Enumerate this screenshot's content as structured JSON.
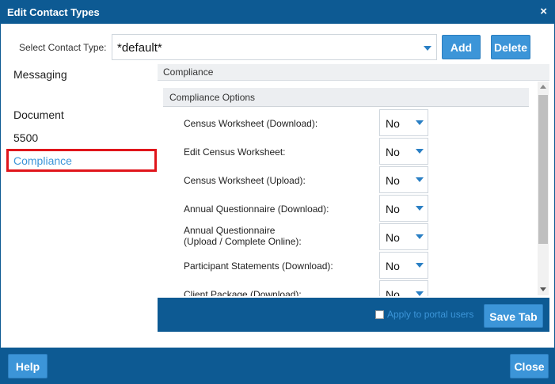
{
  "dialog": {
    "title": "Edit Contact Types",
    "close_glyph": "×"
  },
  "contact_type": {
    "label": "Select Contact Type:",
    "value": "*default*",
    "add_label": "Add",
    "delete_label": "Delete"
  },
  "nav": {
    "items": [
      {
        "label": "Messaging",
        "selected": false
      },
      {
        "label": "Document",
        "selected": false
      },
      {
        "label": "5500",
        "selected": false
      },
      {
        "label": "Compliance",
        "selected": true
      }
    ]
  },
  "panel": {
    "header": "Compliance",
    "section_title": "Compliance Options",
    "rows": [
      {
        "label": "Census Worksheet (Download):",
        "value": "No"
      },
      {
        "label": "Edit Census Worksheet:",
        "value": "No"
      },
      {
        "label": "Census Worksheet (Upload):",
        "value": "No"
      },
      {
        "label": "Annual Questionnaire (Download):",
        "value": "No"
      },
      {
        "label_line1": "Annual Questionnaire",
        "label_line2": "(Upload / Complete Online):",
        "value": "No"
      },
      {
        "label": "Participant Statements (Download):",
        "value": "No"
      },
      {
        "label": "Client Package (Download):",
        "value": "No"
      }
    ],
    "apply_label": "Apply to portal users",
    "save_tab_label": "Save Tab"
  },
  "footer": {
    "help_label": "Help",
    "close_label": "Close"
  },
  "colors": {
    "brand": "#0d5a93",
    "button": "#3c95d8",
    "highlight": "#e0151b"
  }
}
